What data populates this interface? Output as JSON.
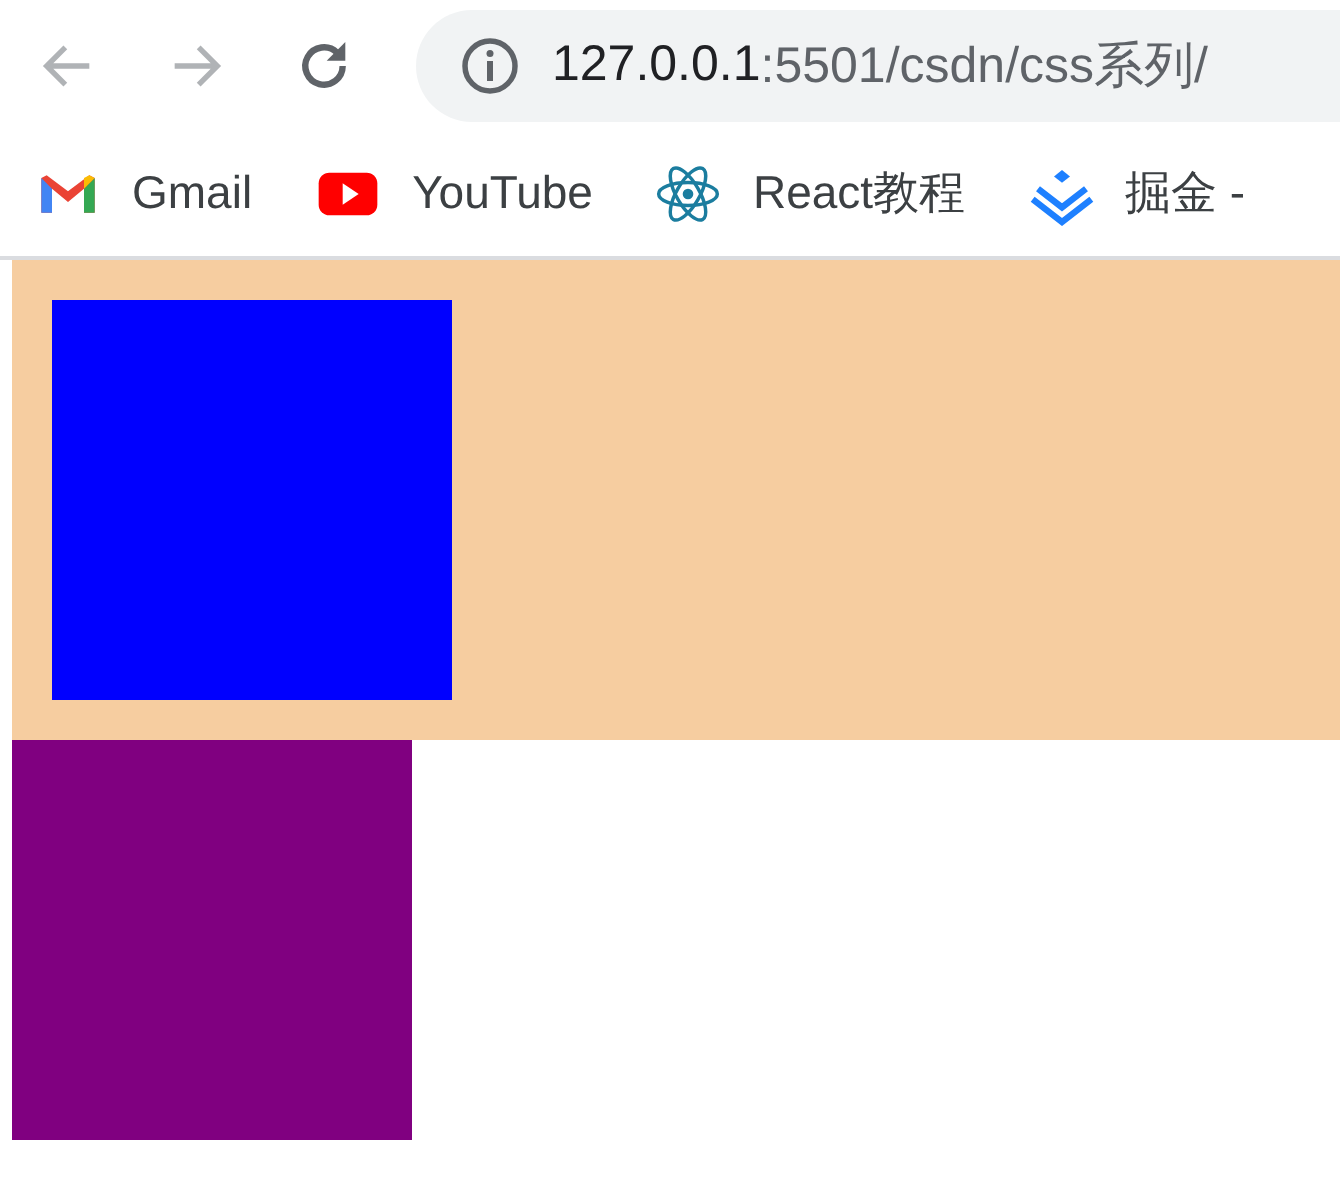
{
  "toolbar": {
    "address": {
      "host": "127.0.0.1",
      "path": ":5501/csdn/css系列/"
    }
  },
  "bookmarks": [
    {
      "label": "Gmail",
      "kind": "gmail"
    },
    {
      "label": "YouTube",
      "kind": "youtube"
    },
    {
      "label": "React教程",
      "kind": "react"
    },
    {
      "label": "掘金 -",
      "kind": "juejin"
    }
  ],
  "page": {
    "container": {
      "color": "#f6cda0"
    },
    "blocks": [
      {
        "kind": "inner",
        "color": "#0000ff"
      },
      {
        "kind": "outer",
        "color": "#800080"
      }
    ]
  }
}
